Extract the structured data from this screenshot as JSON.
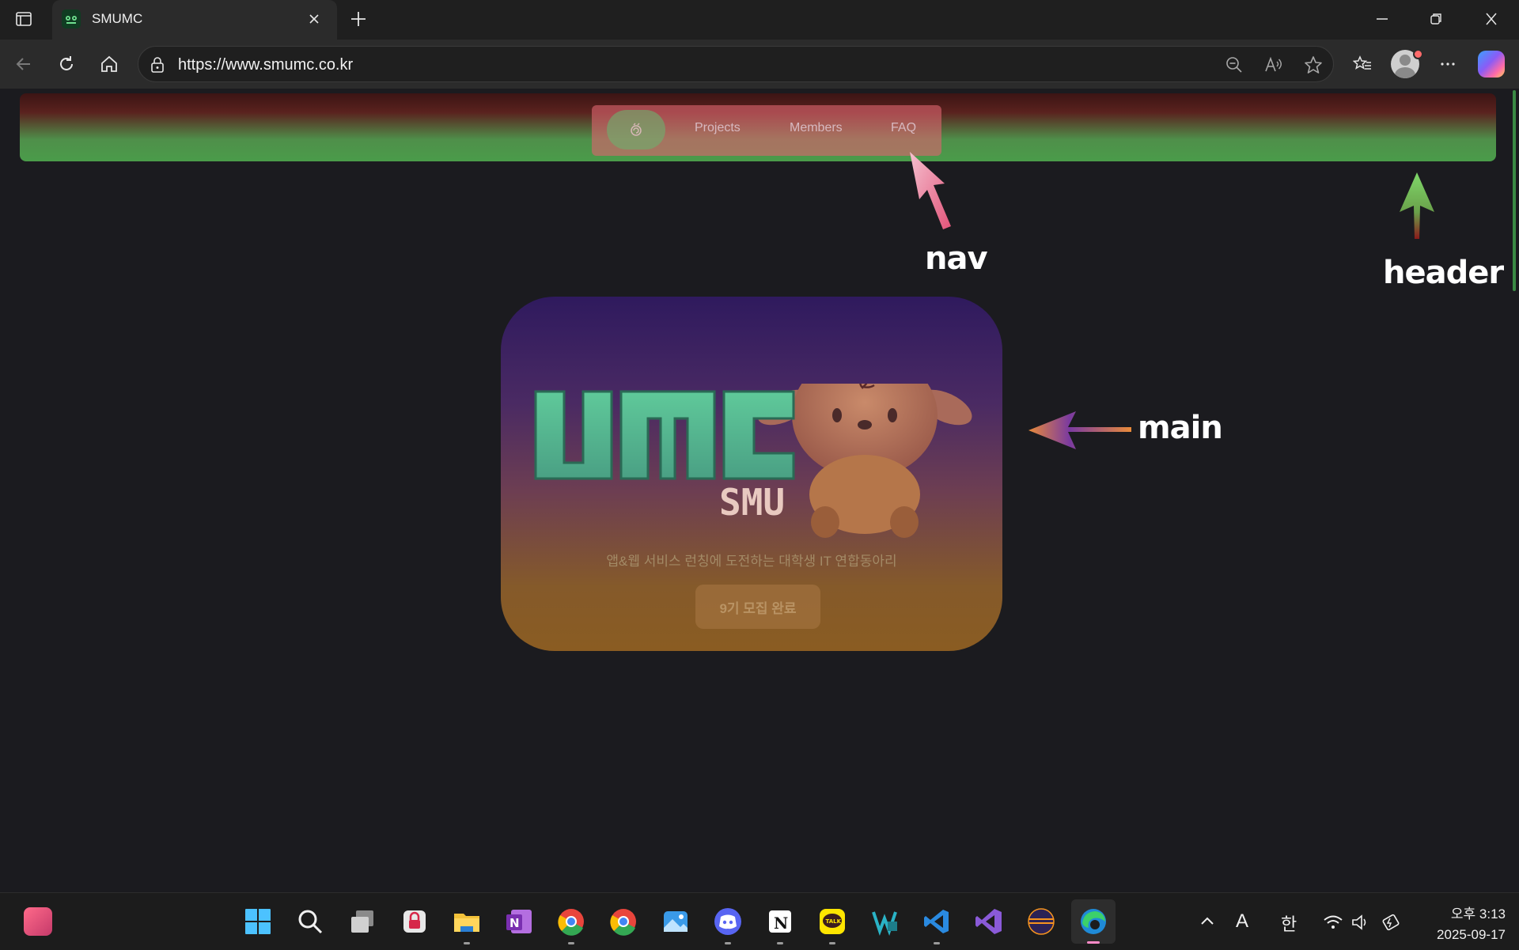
{
  "browser": {
    "tab": {
      "title": "SMUMC"
    },
    "address": {
      "url": "https://www.smumc.co.kr"
    }
  },
  "site": {
    "nav": {
      "home_icon": "home-swirl-icon",
      "links": [
        "Projects",
        "Members",
        "FAQ"
      ]
    },
    "hero": {
      "logo_text": "UMC",
      "logo_subtext": "SMU",
      "tagline": "앱&웹 서비스 런칭에 도전하는 대학생 IT 연합동아리",
      "button_label": "9기 모집 완료"
    }
  },
  "annotations": {
    "nav": "nav",
    "header": "header",
    "main": "main"
  },
  "taskbar": {
    "tray": {
      "ime_mode": "A",
      "ime_lang": "한"
    },
    "clock": {
      "time": "오후 3:13",
      "date": "2025-09-17"
    }
  },
  "colors": {
    "header_top": "#3b1414",
    "header_bottom": "#4a9c4a",
    "nav_bg": "#da646e",
    "hero_top": "#2f1a5e",
    "hero_bottom": "#8a5c22",
    "logo_green": "#5fc99a"
  }
}
